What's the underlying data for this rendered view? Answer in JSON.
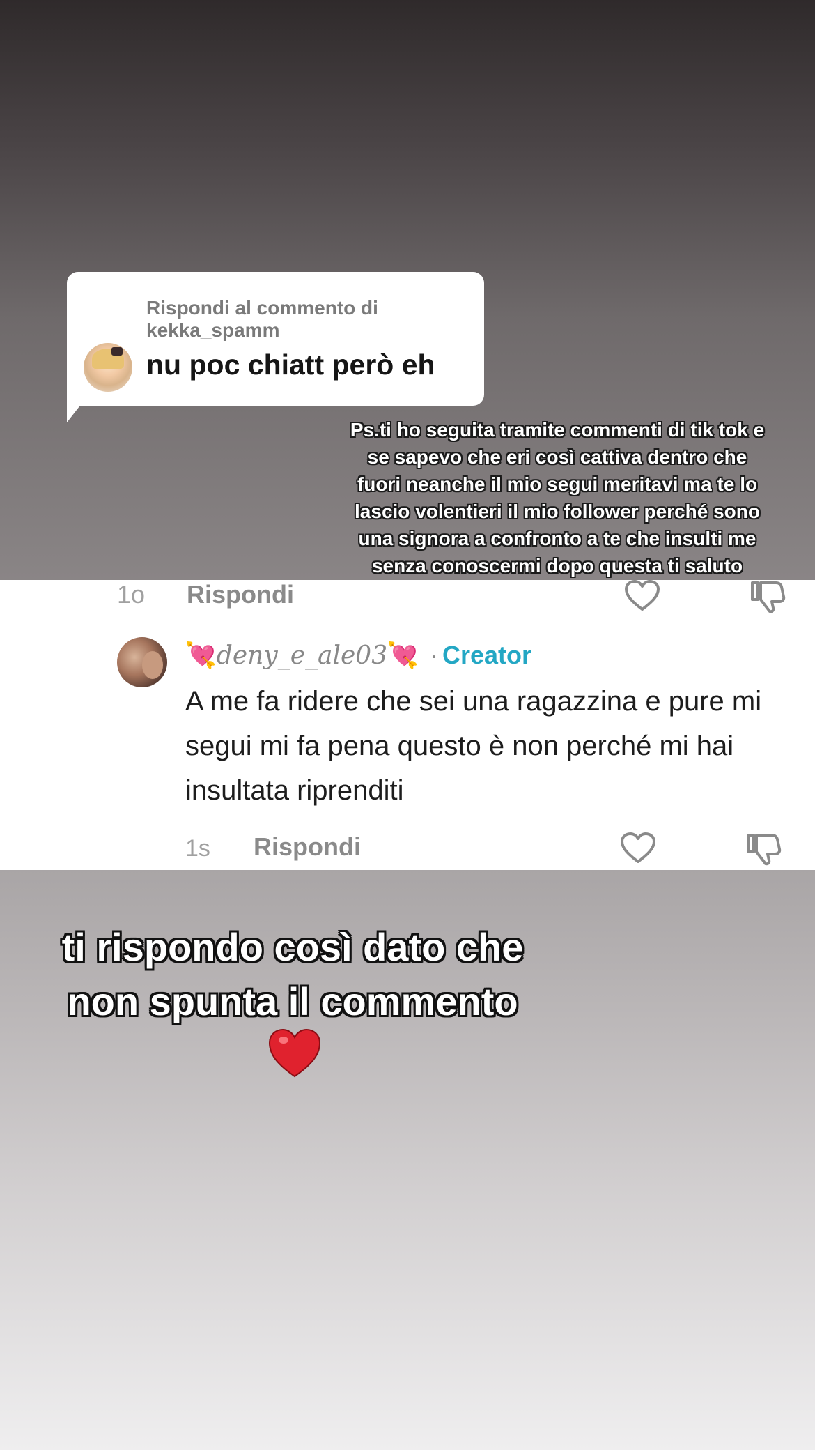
{
  "reply_bubble": {
    "header": "Rispondi al commento di kekka_spamm",
    "text": "nu poc chiatt però eh"
  },
  "overlay_small": {
    "lines": [
      "Ps.ti ho seguita tramite commenti di tik tok e",
      "se sapevo che eri così cattiva dentro che",
      "fuori neanche il mio segui meritavi ma te lo",
      "lascio volentieri il mio follower perché sono",
      "una signora a confronto a te che insulti me",
      "senza conoscermi dopo questa ti saluto"
    ]
  },
  "comment_card": {
    "top_row": {
      "age": "1o",
      "reply": "Rispondi"
    },
    "comment": {
      "emoji_left": "💘",
      "username": "deny_e_ale03",
      "emoji_right": "💘",
      "separator": "·",
      "badge": "Creator",
      "text": "A me fa ridere che sei una ragazzina e pure mi segui mi fa pena questo è non perché mi hai insultata riprenditi",
      "age": "1s",
      "reply": "Rispondi"
    },
    "icons": {
      "like": "heart-outline-icon",
      "dislike": "thumbs-down-icon"
    }
  },
  "overlay_big": {
    "line1": "ti rispondo così dato che",
    "line2": "non spunta il commento"
  },
  "colors": {
    "creator": "#23a7c4",
    "heart": "#e0222e",
    "pink_heart": "#e5397a"
  }
}
